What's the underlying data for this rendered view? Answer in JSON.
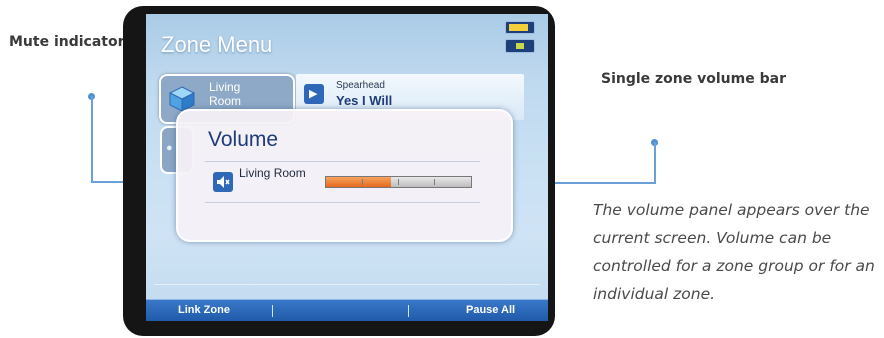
{
  "annotations": {
    "mute_indicator": "Mute indicator",
    "volume_bar": "Single zone volume bar",
    "caption": "The volume panel appears over the current screen. Volume can be controlled for a zone group or for an individual zone."
  },
  "screen": {
    "title": "Zone Menu",
    "zone_tile": {
      "label": "Living Room"
    },
    "now_playing": {
      "artist": "Spearhead",
      "track": "Yes I Will",
      "play_icon": "play-icon"
    },
    "status": {
      "battery_icon": "battery-icon",
      "signal_icon": "signal-icon"
    }
  },
  "volume_panel": {
    "title": "Volume",
    "zone_label": "Living Room",
    "mute_icon": "speaker-muted-icon",
    "level": 0.45
  },
  "softkeys": {
    "left": "Link Zone",
    "right": "Pause All"
  },
  "colors": {
    "accent": "#2f68b8",
    "volume_fill": "#e46a1e",
    "leader_line": "#6aa0d8",
    "title_text": "#1f3c78"
  }
}
